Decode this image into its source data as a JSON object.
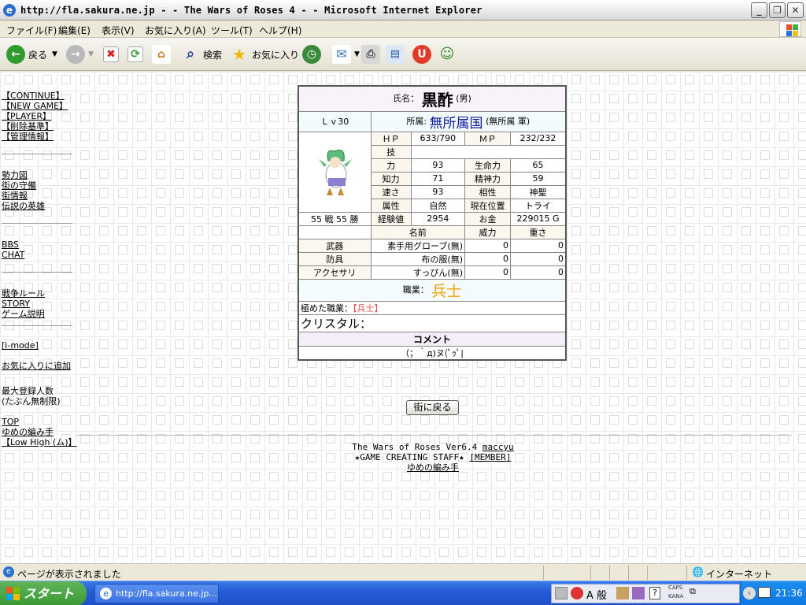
{
  "window": {
    "title": "http://fla.sakura.ne.jp - - The Wars of Roses 4 - - Microsoft Internet Explorer"
  },
  "menu": [
    "ファイル(F)",
    "編集(E)",
    "表示(V)",
    "お気に入り(A)",
    "ツール(T)",
    "ヘルプ(H)"
  ],
  "toolbar": {
    "back": "戻る",
    "search": "検索",
    "favorites": "お気に入り"
  },
  "sidebar": {
    "group1": [
      "【CONTINUE】",
      "【NEW GAME】",
      "【PLAYER】",
      "【削除基準】",
      "【管理情報】"
    ],
    "group2": [
      "勢力図",
      "街の守備",
      "街情報",
      "伝説の英雄"
    ],
    "group3": [
      "BBS",
      "CHAT"
    ],
    "group4": [
      "戦争ルール",
      "STORY",
      "ゲーム説明"
    ],
    "group5": [
      "[i-mode]"
    ],
    "group6": [
      "お気に入りに追加"
    ],
    "max_reg": [
      "最大登録人数",
      "(たぶん無制限)"
    ],
    "group7": [
      "TOP",
      "ゆめの編み手",
      "【Low High (ム)】"
    ]
  },
  "status": {
    "name_label": "氏名：",
    "name": "黒酢",
    "gender": "(男)",
    "level": "Ｌｖ30",
    "affil_label": "所属:",
    "affil_country": "無所属国",
    "affil_sub": "(無所属 軍)",
    "hp_label": "ＨＰ",
    "hp": "633/790",
    "mp_label": "ＭＰ",
    "mp": "232/232",
    "skill_label": "技",
    "power_label": "力",
    "power": "93",
    "life_label": "生命力",
    "life": "65",
    "int_label": "知力",
    "int": "71",
    "mental_label": "精神力",
    "mental": "59",
    "speed_label": "速さ",
    "speed": "93",
    "affinity_label": "相性",
    "affinity": "神聖",
    "attr_label": "属性",
    "attr": "自然",
    "loc_label": "現在位置",
    "loc": "トライ",
    "record": "55 戦 55 勝",
    "exp_label": "経験値",
    "exp": "2954",
    "gold_label": "お金",
    "gold": "229015 G",
    "eq_name_h": "名前",
    "eq_power_h": "威力",
    "eq_weight_h": "重さ",
    "equipment": [
      {
        "slot": "武器",
        "name": "素手用グローブ(無)",
        "power": "0",
        "weight": "0"
      },
      {
        "slot": "防具",
        "name": "布の服(無)",
        "power": "0",
        "weight": "0"
      },
      {
        "slot": "アクセサリ",
        "name": "すっぴん(無)",
        "power": "0",
        "weight": "0"
      }
    ],
    "job_label": "職業：",
    "job": "兵士",
    "mastered_label": "極めた職業：",
    "mastered": "【兵士】",
    "crystal_label": "クリスタル：",
    "comment_label": "コメント",
    "comment": "（；｀д)ヌ(ﾟｩﾟ|"
  },
  "back_button": "街に戻る",
  "footer": {
    "line1": "The Wars of Roses Ver6.4",
    "author": "maccyu",
    "line2": "★GAME CREATING STAFF★",
    "member": "[MEMBER]",
    "line3": "ゆめの編み手"
  },
  "statusbar": {
    "text": "ページが表示されました",
    "zone": "インターネット"
  },
  "taskbar": {
    "start": "スタート",
    "task": "http://fla.sakura.ne.jp...",
    "ime": "A 般",
    "caps": "CAPS",
    "kana": "KANA",
    "clock": "21:36"
  }
}
